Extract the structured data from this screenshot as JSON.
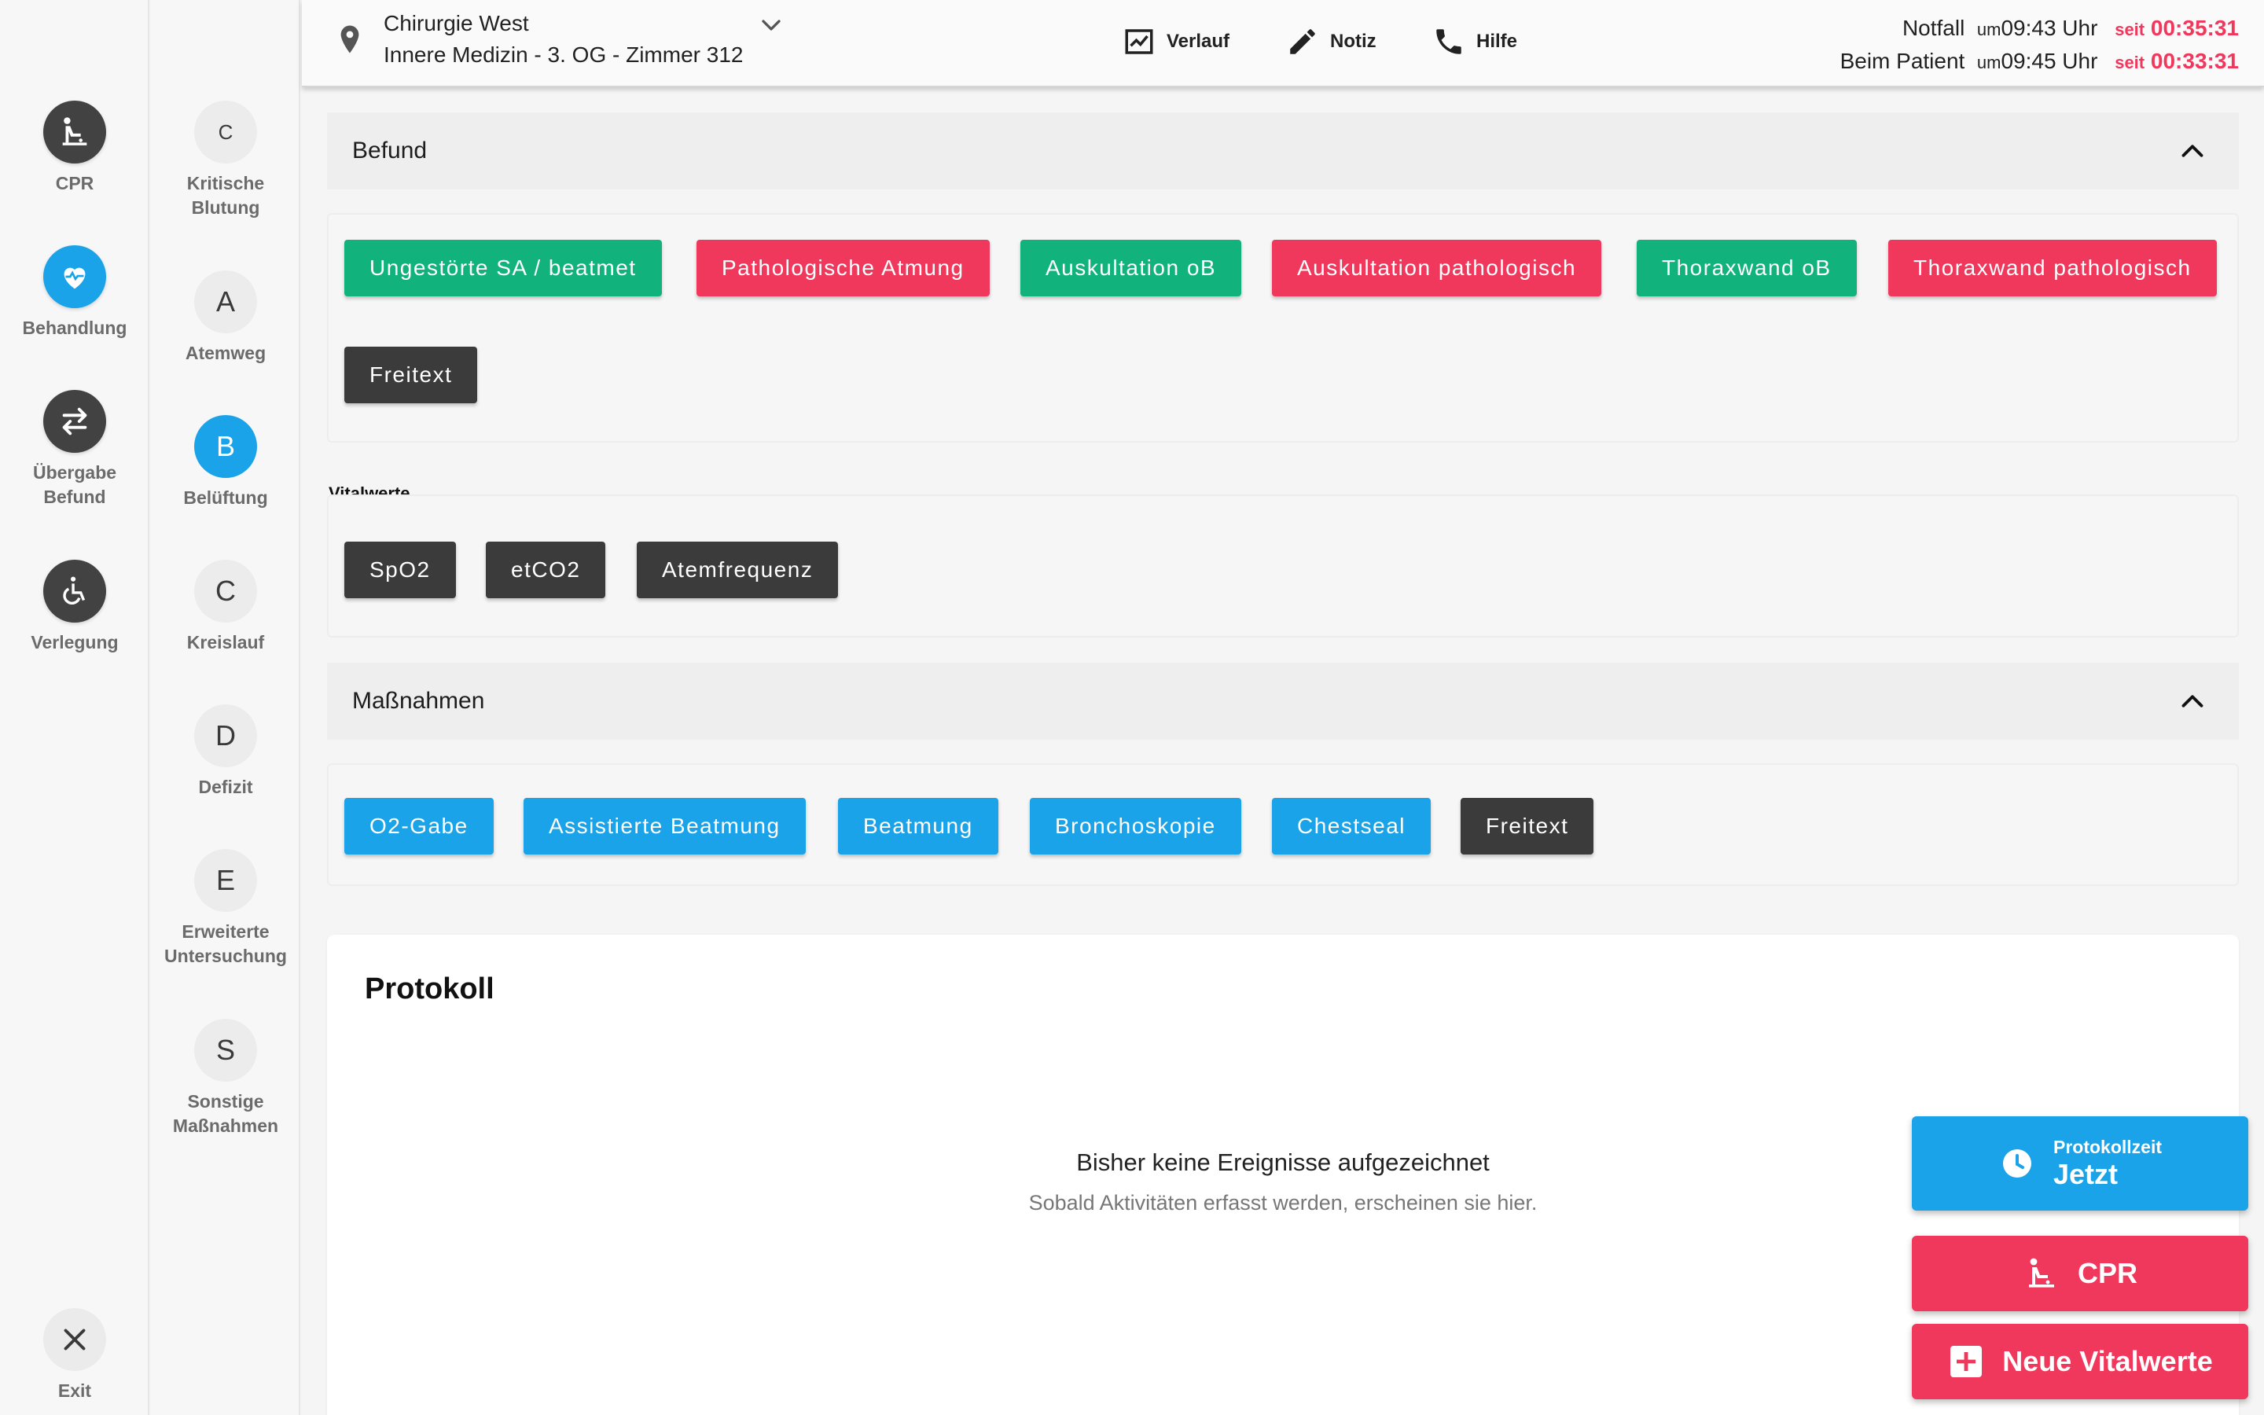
{
  "rail": {
    "items": [
      {
        "label": "CPR",
        "icon": "cpr-icon"
      },
      {
        "label": "Behandlung",
        "icon": "heart-pulse-icon"
      },
      {
        "label": "Übergabe\nBefund",
        "icon": "swap-arrows-icon"
      },
      {
        "label": "Verlegung",
        "icon": "wheelchair-icon"
      }
    ],
    "exit_label": "Exit"
  },
  "abcde": {
    "items": [
      {
        "letter": "C",
        "label": "Kritische\nBlutung"
      },
      {
        "letter": "A",
        "label": "Atemweg"
      },
      {
        "letter": "B",
        "label": "Belüftung"
      },
      {
        "letter": "C",
        "label": "Kreislauf"
      },
      {
        "letter": "D",
        "label": "Defizit"
      },
      {
        "letter": "E",
        "label": "Erweiterte\nUntersuchung"
      },
      {
        "letter": "S",
        "label": "Sonstige\nMaßnahmen"
      }
    ]
  },
  "header": {
    "location_line1": "Chirurgie West",
    "location_line2": "Innere Medizin - 3. OG - Zimmer 312",
    "buttons": {
      "verlauf": "Verlauf",
      "notiz": "Notiz",
      "hilfe": "Hilfe"
    },
    "times": [
      {
        "label": "Notfall",
        "um": "um",
        "time": "09:43 Uhr",
        "seit": "seit",
        "duration": "00:35:31"
      },
      {
        "label": "Beim Patient",
        "um": "um",
        "time": "09:45 Uhr",
        "seit": "seit",
        "duration": "00:33:31"
      }
    ]
  },
  "befund": {
    "title": "Befund",
    "chips": [
      "Ungestörte SA / beatmet",
      "Pathologische Atmung",
      "Auskultation oB",
      "Auskultation pathologisch",
      "Thoraxwand oB",
      "Thoraxwand pathologisch",
      "Freitext"
    ]
  },
  "vitalwerte": {
    "title": "Vitalwerte",
    "chips": [
      "SpO2",
      "etCO2",
      "Atemfrequenz"
    ]
  },
  "massnahmen": {
    "title": "Maßnahmen",
    "chips": [
      "O2-Gabe",
      "Assistierte Beatmung",
      "Beatmung",
      "Bronchoskopie",
      "Chestseal",
      "Freitext"
    ]
  },
  "protokoll": {
    "title": "Protokoll",
    "empty_title": "Bisher keine Ereignisse aufgezeichnet",
    "empty_sub": "Sobald Aktivitäten erfasst werden, erscheinen sie hier."
  },
  "fabs": {
    "time_small": "Protokollzeit",
    "time_big": "Jetzt",
    "cpr": "CPR",
    "vital": "Neue Vitalwerte"
  },
  "colors": {
    "accent_blue": "#1aa3e8",
    "green": "#12b27c",
    "red": "#f0385c",
    "dark": "#3b3b3b"
  }
}
